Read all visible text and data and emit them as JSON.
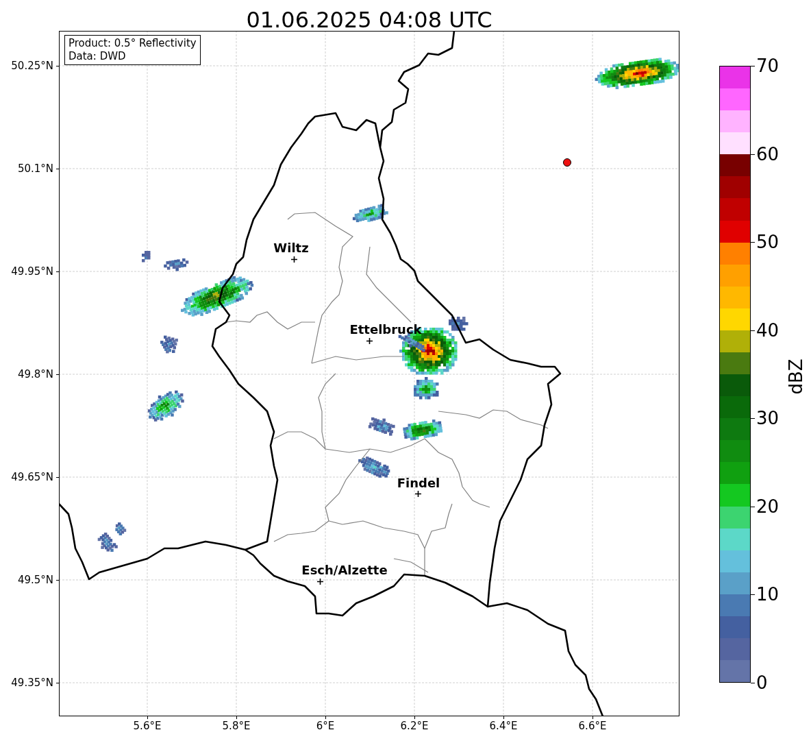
{
  "title": "01.06.2025 04:08 UTC",
  "info_box": [
    "Product: 0.5° Reflectivity",
    "Data: DWD"
  ],
  "map": {
    "lat_ticks": [
      "50.25°N",
      "50.1°N",
      "49.95°N",
      "49.8°N",
      "49.65°N",
      "49.5°N",
      "49.35°N"
    ],
    "lon_ticks": [
      "5.6°E",
      "5.8°E",
      "6°E",
      "6.2°E",
      "6.4°E",
      "6.6°E"
    ],
    "cities": [
      {
        "name": "Wiltz"
      },
      {
        "name": "Ettelbruck"
      },
      {
        "name": "Findel"
      },
      {
        "name": "Esch/Alzette"
      }
    ]
  },
  "colorbar": {
    "label": "dBZ",
    "ticks": [
      "70",
      "60",
      "50",
      "40",
      "30",
      "20",
      "10",
      "0"
    ],
    "bands": [
      {
        "color": "#ea33e8"
      },
      {
        "color": "#ff66ff"
      },
      {
        "color": "#ffb3ff"
      },
      {
        "color": "#ffe0ff"
      },
      {
        "color": "#780000"
      },
      {
        "color": "#a00000"
      },
      {
        "color": "#c00000"
      },
      {
        "color": "#e00000"
      },
      {
        "color": "#ff8000"
      },
      {
        "color": "#ffa000"
      },
      {
        "color": "#ffb800"
      },
      {
        "color": "#ffd700"
      },
      {
        "color": "#b0b008"
      },
      {
        "color": "#4a7a10"
      },
      {
        "color": "#0a5a0a"
      },
      {
        "color": "#0a6a0a"
      },
      {
        "color": "#0e7a10"
      },
      {
        "color": "#108c10"
      },
      {
        "color": "#10a010"
      },
      {
        "color": "#14c820"
      },
      {
        "color": "#3cd470"
      },
      {
        "color": "#5cd8c8"
      },
      {
        "color": "#64c0dc"
      },
      {
        "color": "#5aa0c8"
      },
      {
        "color": "#4a7ab2"
      },
      {
        "color": "#4460a0"
      },
      {
        "color": "#5565a0"
      },
      {
        "color": "#6474a8"
      }
    ]
  }
}
